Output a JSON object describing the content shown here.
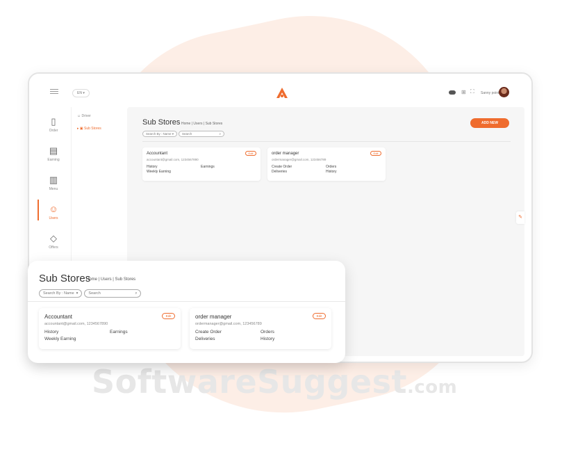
{
  "watermark": {
    "brand": "SoftwareSuggest",
    "tld": ".com"
  },
  "topbar": {
    "language": "EN",
    "user_name": "Sanny point"
  },
  "sidebar": {
    "items": [
      {
        "label": "Order",
        "icon": "phone-icon"
      },
      {
        "label": "Earning",
        "icon": "money-icon"
      },
      {
        "label": "Menu",
        "icon": "menu-book-icon"
      },
      {
        "label": "Users",
        "icon": "users-icon"
      },
      {
        "label": "Offers",
        "icon": "tag-icon"
      }
    ]
  },
  "subnav": {
    "items": [
      {
        "label": "Driver"
      },
      {
        "label": "Sub Stores"
      }
    ]
  },
  "page": {
    "title": "Sub Stores",
    "breadcrumb": [
      "Home",
      "Users",
      "Sub Stores"
    ],
    "search_by": "Search By : Name",
    "search_placeholder": "Search",
    "add_button": "ADD NEW",
    "edit_label": "Edit"
  },
  "cards": [
    {
      "title": "Accountant",
      "email": "accountant@gmail.com, 1234567890",
      "features": [
        "History",
        "Earnings",
        "Weekly Earning"
      ]
    },
    {
      "title": "order manager",
      "email": "ordermanager@gmail.com, 123456789",
      "features": [
        "Create Order",
        "Orders",
        "Deliveries",
        "History"
      ]
    }
  ],
  "colors": {
    "accent": "#ef6c2e",
    "background_shape": "#fdeee6"
  }
}
